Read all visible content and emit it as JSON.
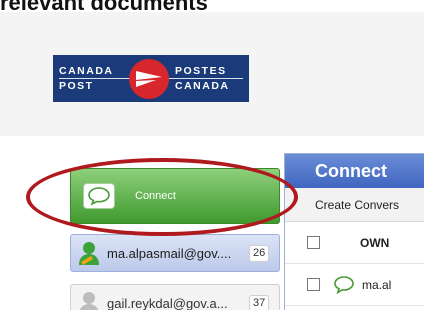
{
  "top_heading": "relevant documents",
  "logo": {
    "left_top": "CANADA",
    "left_bottom": "POST",
    "right_top": "POSTES",
    "right_bottom": "CANADA"
  },
  "sidebar": {
    "connect_label": "Connect",
    "users": [
      {
        "label": "ma.alpasmail@gov....",
        "count": "26"
      },
      {
        "label": "gail.reykdal@gov.a...",
        "count": "37"
      }
    ]
  },
  "panel": {
    "title": "Connect",
    "create_label": "Create Convers",
    "owner_col": "OWN",
    "row_text": "ma.al"
  },
  "colors": {
    "accent_green": "#3f9a2e",
    "panel_blue": "#3f65bf",
    "highlight_red": "#b01a1e",
    "logo_blue": "#1a3a7a",
    "logo_red": "#d7262c"
  },
  "icons": [
    "speech-bubble-icon",
    "user-avatar-icon",
    "canada-post-logo"
  ]
}
